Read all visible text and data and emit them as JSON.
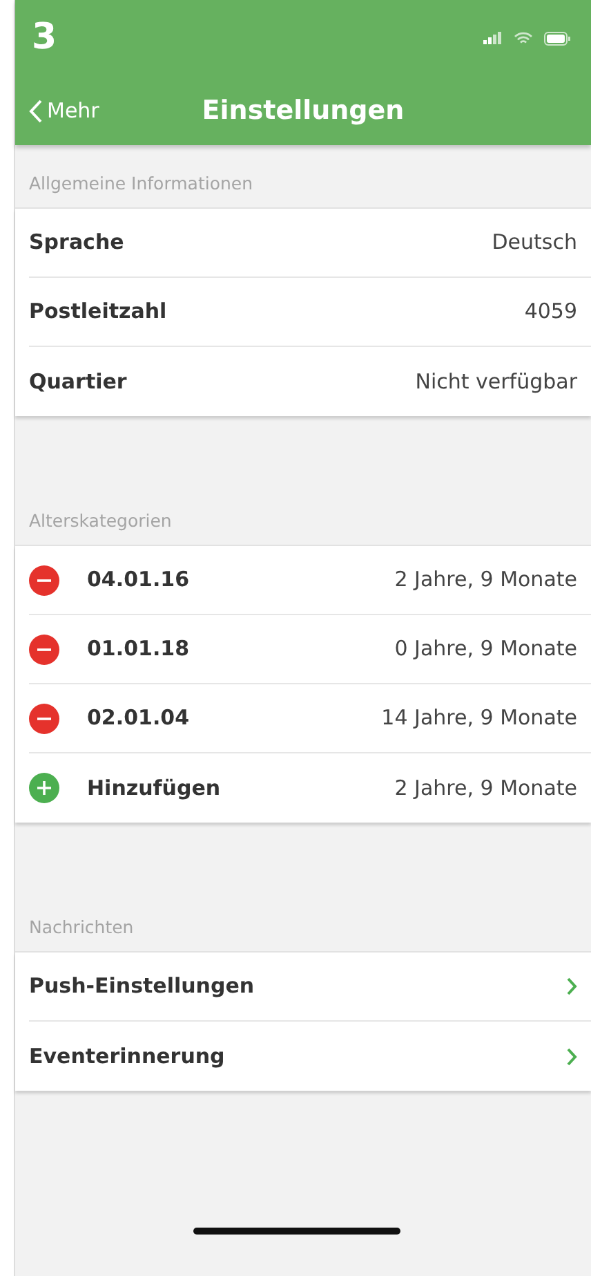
{
  "step_number": "3",
  "nav": {
    "back": "Mehr",
    "title": "Einstellungen"
  },
  "sections": [
    {
      "title": "Allgemeine Informationen",
      "rows": [
        {
          "kind": "value",
          "label": "Sprache",
          "value": "Deutsch"
        },
        {
          "kind": "value",
          "label": "Postleitzahl",
          "value": "4059"
        },
        {
          "kind": "value",
          "label": "Quartier",
          "value": "Nicht verfügbar"
        }
      ]
    },
    {
      "title": "Alterskategorien",
      "rows": [
        {
          "kind": "remove",
          "label": "04.01.16",
          "value": "2 Jahre, 9 Monate"
        },
        {
          "kind": "remove",
          "label": "01.01.18",
          "value": "0 Jahre, 9 Monate"
        },
        {
          "kind": "remove",
          "label": "02.01.04",
          "value": "14 Jahre, 9 Monate"
        },
        {
          "kind": "add",
          "label": "Hinzufügen",
          "value": "2 Jahre, 9 Monate"
        }
      ]
    },
    {
      "title": "Nachrichten",
      "rows": [
        {
          "kind": "link",
          "label": "Push-Einstellungen"
        },
        {
          "kind": "link",
          "label": "Eventerinnerung"
        }
      ]
    }
  ]
}
